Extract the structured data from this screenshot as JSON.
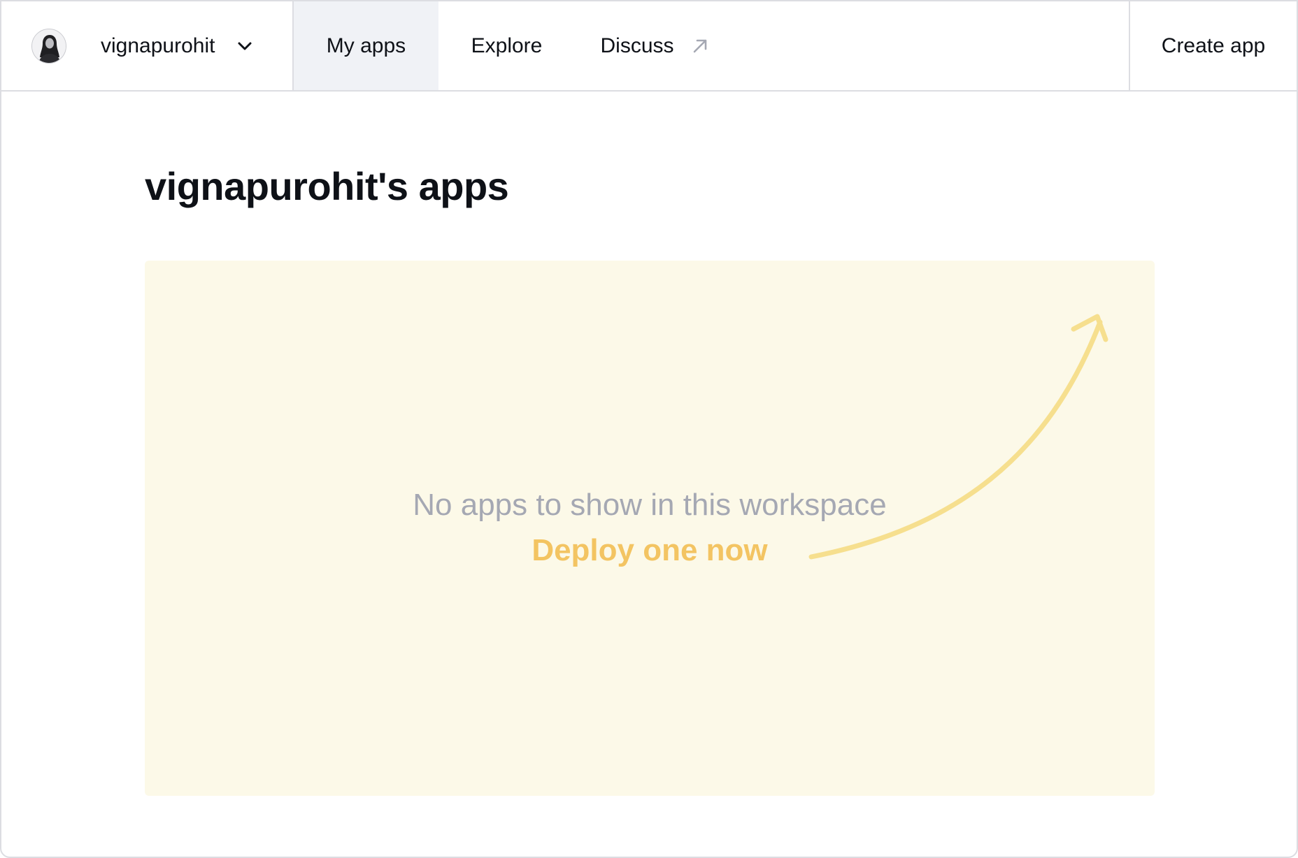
{
  "header": {
    "workspace_name": "vignapurohit",
    "tabs": [
      {
        "label": "My apps",
        "active": true
      },
      {
        "label": "Explore",
        "active": false
      },
      {
        "label": "Discuss",
        "active": false,
        "external": true
      }
    ],
    "create_label": "Create app"
  },
  "main": {
    "title": "vignapurohit's apps",
    "empty_message": "No apps to show in this workspace",
    "deploy_label": "Deploy one now"
  },
  "icons": {
    "avatar": "user-avatar",
    "workspace_menu": "chevron-down-icon",
    "discuss_external": "external-link-arrow-icon",
    "deploy_hint": "curved-arrow-icon"
  },
  "colors": {
    "active_tab_bg": "#f0f2f6",
    "border": "#dcdde2",
    "panel_bg": "#fcf9e8",
    "muted_text": "#a5a8b3",
    "deploy_accent": "#f3c462",
    "hint_arrow": "#f6df8e"
  }
}
